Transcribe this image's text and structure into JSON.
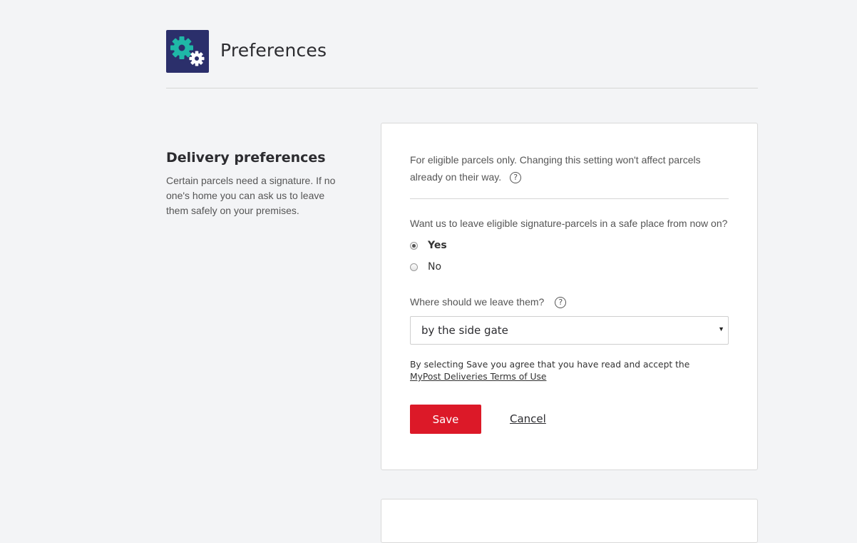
{
  "header": {
    "title": "Preferences",
    "icon": "gears-icon",
    "icon_bg": "#2b2f6b",
    "icon_colors": [
      "#1fb8a7",
      "#ffffff"
    ]
  },
  "section": {
    "heading": "Delivery preferences",
    "description": "Certain parcels need a signature. If no one's home you can ask us to leave them safely on your premises."
  },
  "form": {
    "intro": "For eligible parcels only. Changing this setting won't affect parcels already on their way.",
    "help_symbol": "?",
    "question": "Want us to leave eligible signature-parcels in a safe place from now on?",
    "options": [
      {
        "label": "Yes",
        "checked": true
      },
      {
        "label": "No",
        "checked": false
      }
    ],
    "where_label": "Where should we leave them?",
    "location_select": {
      "value": "by the side gate",
      "caret": "▼"
    },
    "terms_text": "By selecting Save you agree that you have read and accept the",
    "terms_link": "MyPost Deliveries Terms of Use",
    "save_label": "Save",
    "cancel_label": "Cancel"
  },
  "colors": {
    "page_bg": "#f3f4f6",
    "accent_red": "#dc1928",
    "card_border": "#d9d9d9"
  }
}
